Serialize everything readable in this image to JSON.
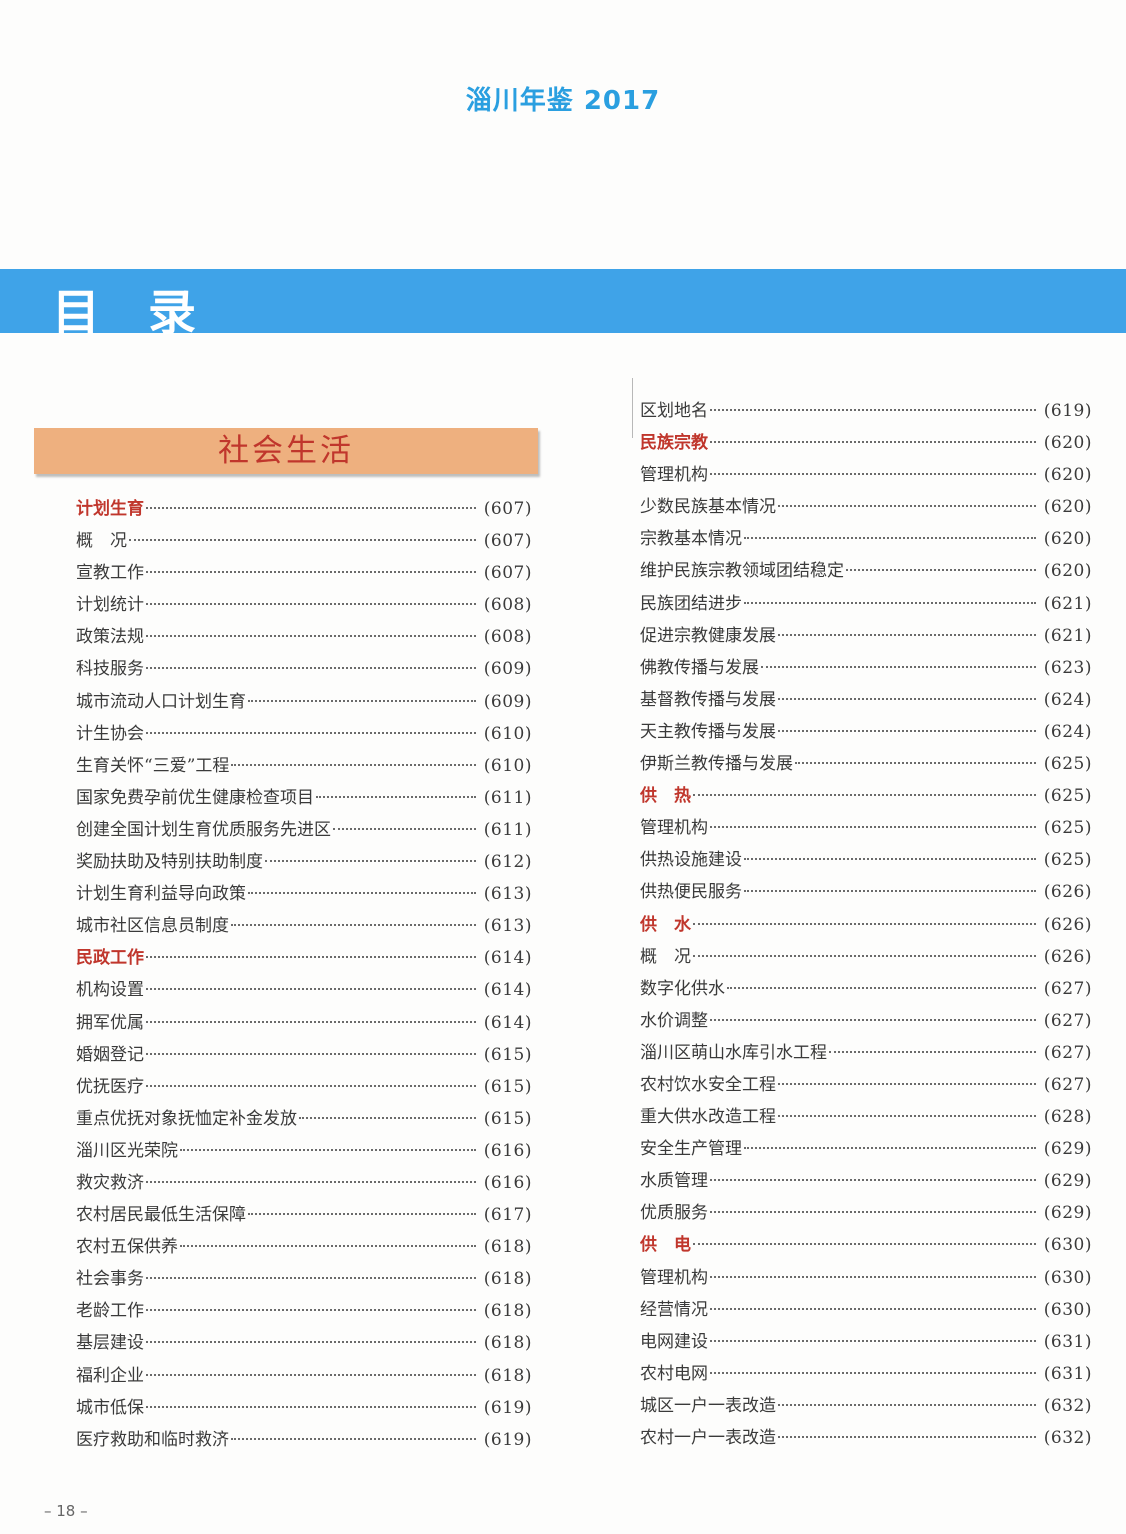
{
  "header": {
    "title": "淄川年鉴 2017"
  },
  "banner": {
    "title": "目录"
  },
  "section": {
    "title": "社会生活"
  },
  "left_entries": [
    {
      "label": "计划生育",
      "page": "(607)",
      "heading": true
    },
    {
      "label": "概　况",
      "page": "(607)",
      "heading": false
    },
    {
      "label": "宣教工作",
      "page": "(607)",
      "heading": false
    },
    {
      "label": "计划统计",
      "page": "(608)",
      "heading": false
    },
    {
      "label": "政策法规",
      "page": "(608)",
      "heading": false
    },
    {
      "label": "科技服务",
      "page": "(609)",
      "heading": false
    },
    {
      "label": "城市流动人口计划生育",
      "page": "(609)",
      "heading": false
    },
    {
      "label": "计生协会",
      "page": "(610)",
      "heading": false
    },
    {
      "label": "生育关怀“三爱”工程",
      "page": "(610)",
      "heading": false
    },
    {
      "label": "国家免费孕前优生健康检查项目",
      "page": "(611)",
      "heading": false
    },
    {
      "label": "创建全国计划生育优质服务先进区",
      "page": "(611)",
      "heading": false
    },
    {
      "label": "奖励扶助及特别扶助制度",
      "page": "(612)",
      "heading": false
    },
    {
      "label": "计划生育利益导向政策",
      "page": "(613)",
      "heading": false
    },
    {
      "label": "城市社区信息员制度",
      "page": "(613)",
      "heading": false
    },
    {
      "label": "民政工作",
      "page": "(614)",
      "heading": true
    },
    {
      "label": "机构设置",
      "page": "(614)",
      "heading": false
    },
    {
      "label": "拥军优属",
      "page": "(614)",
      "heading": false
    },
    {
      "label": "婚姻登记",
      "page": "(615)",
      "heading": false
    },
    {
      "label": "优抚医疗",
      "page": "(615)",
      "heading": false
    },
    {
      "label": "重点优抚对象抚恤定补金发放",
      "page": "(615)",
      "heading": false
    },
    {
      "label": "淄川区光荣院",
      "page": "(616)",
      "heading": false
    },
    {
      "label": "救灾救济",
      "page": "(616)",
      "heading": false
    },
    {
      "label": "农村居民最低生活保障",
      "page": "(617)",
      "heading": false
    },
    {
      "label": "农村五保供养",
      "page": "(618)",
      "heading": false
    },
    {
      "label": "社会事务",
      "page": "(618)",
      "heading": false
    },
    {
      "label": "老龄工作",
      "page": "(618)",
      "heading": false
    },
    {
      "label": "基层建设",
      "page": "(618)",
      "heading": false
    },
    {
      "label": "福利企业",
      "page": "(618)",
      "heading": false
    },
    {
      "label": "城市低保",
      "page": "(619)",
      "heading": false
    },
    {
      "label": "医疗救助和临时救济",
      "page": "(619)",
      "heading": false
    }
  ],
  "right_entries": [
    {
      "label": "区划地名",
      "page": "(619)",
      "heading": false
    },
    {
      "label": "民族宗教",
      "page": "(620)",
      "heading": true
    },
    {
      "label": "管理机构",
      "page": "(620)",
      "heading": false
    },
    {
      "label": "少数民族基本情况",
      "page": "(620)",
      "heading": false
    },
    {
      "label": "宗教基本情况",
      "page": "(620)",
      "heading": false
    },
    {
      "label": "维护民族宗教领域团结稳定",
      "page": "(620)",
      "heading": false
    },
    {
      "label": "民族团结进步",
      "page": "(621)",
      "heading": false
    },
    {
      "label": "促进宗教健康发展",
      "page": "(621)",
      "heading": false
    },
    {
      "label": "佛教传播与发展",
      "page": "(623)",
      "heading": false
    },
    {
      "label": "基督教传播与发展",
      "page": "(624)",
      "heading": false
    },
    {
      "label": "天主教传播与发展",
      "page": "(624)",
      "heading": false
    },
    {
      "label": "伊斯兰教传播与发展",
      "page": "(625)",
      "heading": false
    },
    {
      "label": "供　热",
      "page": "(625)",
      "heading": true
    },
    {
      "label": "管理机构",
      "page": "(625)",
      "heading": false
    },
    {
      "label": "供热设施建设",
      "page": "(625)",
      "heading": false
    },
    {
      "label": "供热便民服务",
      "page": "(626)",
      "heading": false
    },
    {
      "label": "供　水",
      "page": "(626)",
      "heading": true
    },
    {
      "label": "概　况",
      "page": "(626)",
      "heading": false
    },
    {
      "label": "数字化供水",
      "page": "(627)",
      "heading": false
    },
    {
      "label": "水价调整",
      "page": "(627)",
      "heading": false
    },
    {
      "label": "淄川区萌山水库引水工程",
      "page": "(627)",
      "heading": false
    },
    {
      "label": "农村饮水安全工程",
      "page": "(627)",
      "heading": false
    },
    {
      "label": "重大供水改造工程",
      "page": "(628)",
      "heading": false
    },
    {
      "label": "安全生产管理",
      "page": "(629)",
      "heading": false
    },
    {
      "label": "水质管理",
      "page": "(629)",
      "heading": false
    },
    {
      "label": "优质服务",
      "page": "(629)",
      "heading": false
    },
    {
      "label": "供　电",
      "page": "(630)",
      "heading": true
    },
    {
      "label": "管理机构",
      "page": "(630)",
      "heading": false
    },
    {
      "label": "经营情况",
      "page": "(630)",
      "heading": false
    },
    {
      "label": "电网建设",
      "page": "(631)",
      "heading": false
    },
    {
      "label": "农村电网",
      "page": "(631)",
      "heading": false
    },
    {
      "label": "城区一户一表改造",
      "page": "(632)",
      "heading": false
    },
    {
      "label": "农村一户一表改造",
      "page": "(632)",
      "heading": false
    }
  ],
  "footer": {
    "page_number": "– 18 –"
  },
  "colors": {
    "accent_blue": "#3fa3e8",
    "heading_red": "#c0362c",
    "section_orange": "#eeb07f"
  }
}
